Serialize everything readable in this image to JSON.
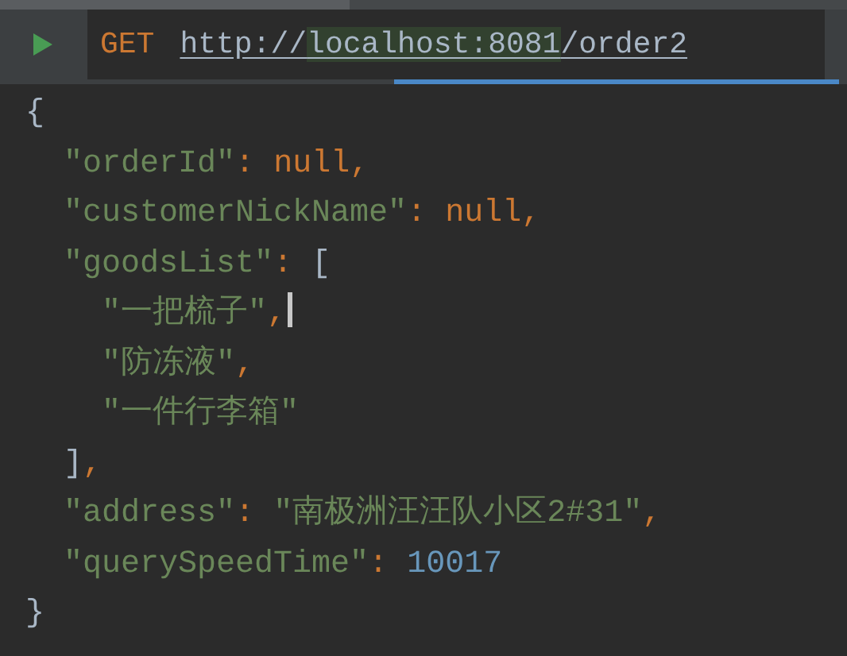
{
  "request": {
    "method": "GET",
    "url_parts": [
      {
        "text": "http://",
        "highlighted": false
      },
      {
        "text": "localhost:8081",
        "highlighted": true
      },
      {
        "text": "/order2",
        "highlighted": false
      }
    ]
  },
  "response": {
    "open": "{",
    "close": "}",
    "entries": [
      {
        "key": "\"orderId\"",
        "colon": ":",
        "value": "null",
        "kind": "keyword",
        "comma": ","
      },
      {
        "key": "\"customerNickName\"",
        "colon": ":",
        "value": "null",
        "kind": "keyword",
        "comma": ","
      },
      {
        "key": "\"goodsList\"",
        "colon": ":",
        "open": "[",
        "close": "]",
        "comma": ",",
        "children": [
          {
            "value": "\"一把梳子\"",
            "kind": "string",
            "comma": ",",
            "caret": true
          },
          {
            "value": "\"防冻液\"",
            "kind": "string",
            "comma": ",",
            "caret": false
          },
          {
            "value": "\"一件行李箱\"",
            "kind": "string",
            "caret": false
          }
        ]
      },
      {
        "key": "\"address\"",
        "colon": ":",
        "value": "\"南极洲汪汪队小区2#31\"",
        "kind": "string",
        "comma": ","
      },
      {
        "key": "\"querySpeedTime\"",
        "colon": ":",
        "value": "10017",
        "kind": "number"
      }
    ]
  }
}
